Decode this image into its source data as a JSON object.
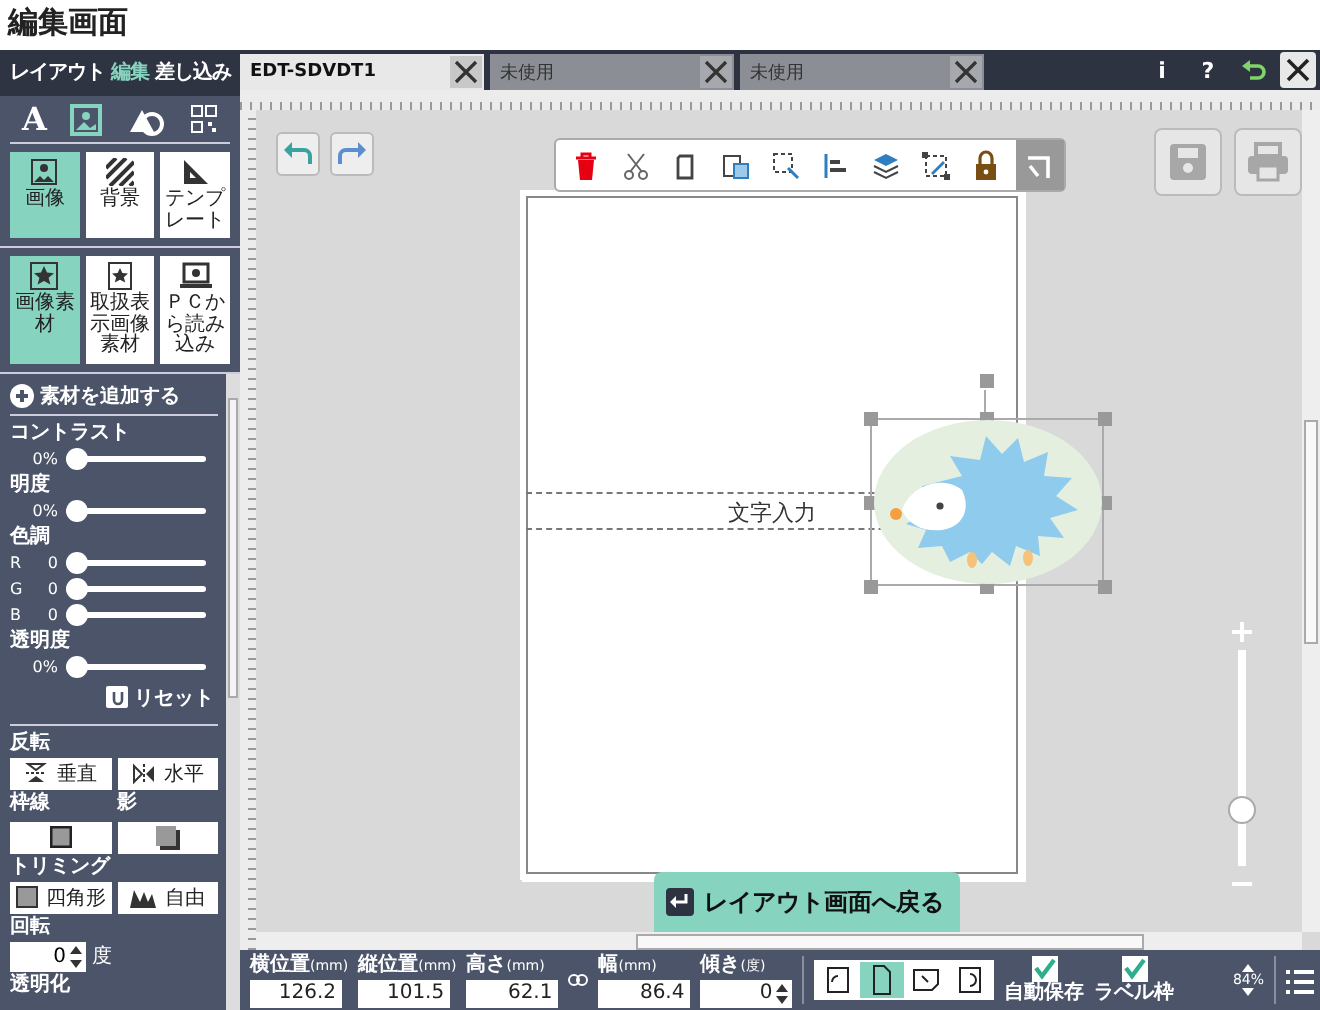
{
  "page_title": "編集画面",
  "sidebar": {
    "tabs": [
      {
        "label": "レイアウト",
        "selected": false
      },
      {
        "label": "編集",
        "selected": true
      },
      {
        "label": "差し込み",
        "selected": false
      }
    ],
    "tools": [
      {
        "kind": "text",
        "label": "A",
        "selected": false
      },
      {
        "kind": "image",
        "selected": true
      },
      {
        "kind": "shape",
        "selected": false
      },
      {
        "kind": "code",
        "selected": false
      }
    ],
    "categories": [
      {
        "kind": "image",
        "label": "画像",
        "selected": true
      },
      {
        "kind": "pattern",
        "label": "背景",
        "selected": false
      },
      {
        "kind": "template",
        "label": "テンプレート",
        "selected": false
      }
    ],
    "sources": [
      {
        "kind": "star",
        "label": "画像素材",
        "selected": true
      },
      {
        "kind": "star-card",
        "label": "取扱表示画像素材",
        "selected": false
      },
      {
        "kind": "pc",
        "label": "ＰＣから読み込み",
        "selected": false
      }
    ],
    "add_button": "素材を追加する",
    "adjustments": [
      {
        "label": "コントラスト",
        "sliders": [
          {
            "reading": "0%",
            "level": 0
          }
        ]
      },
      {
        "label": "明度",
        "sliders": [
          {
            "reading": "0%",
            "level": 0
          }
        ]
      },
      {
        "label": "色調",
        "sliders": [
          {
            "channel": "R",
            "reading": "0",
            "level": 0
          },
          {
            "channel": "G",
            "reading": "0",
            "level": 0
          },
          {
            "channel": "B",
            "reading": "0",
            "level": 0
          }
        ]
      },
      {
        "label": "透明度",
        "sliders": [
          {
            "reading": "0%",
            "level": 0
          }
        ]
      }
    ],
    "reset_button": "リセット",
    "flip": {
      "label": "反転",
      "buttons": [
        {
          "kind": "vertical",
          "label": "垂直"
        },
        {
          "kind": "horizontal",
          "label": "水平"
        }
      ]
    },
    "frame_label": "枠線",
    "shadow_label": "影",
    "trimming": {
      "label": "トリミング",
      "buttons": [
        {
          "kind": "rect",
          "label": "四角形"
        },
        {
          "kind": "free",
          "label": "自由"
        }
      ]
    },
    "rotation": {
      "label": "回転",
      "value": "0",
      "unit": "度"
    },
    "next_section": "透明化"
  },
  "tabs": [
    {
      "label": "EDT-SDVDT1",
      "selected": true
    },
    {
      "label": "未使用",
      "selected": false
    },
    {
      "label": "未使用",
      "selected": false
    }
  ],
  "header_buttons": [
    {
      "kind": "info",
      "label": "i"
    },
    {
      "kind": "help",
      "label": "?"
    },
    {
      "kind": "undo"
    },
    {
      "kind": "close"
    }
  ],
  "edit_toolbar": [
    {
      "kind": "delete"
    },
    {
      "kind": "cut"
    },
    {
      "kind": "copy"
    },
    {
      "kind": "paste"
    },
    {
      "kind": "select"
    },
    {
      "kind": "align"
    },
    {
      "kind": "layers"
    },
    {
      "kind": "transform"
    },
    {
      "kind": "lock"
    },
    {
      "kind": "collapse"
    }
  ],
  "canvas": {
    "text_object": "文字入力",
    "zoom": {
      "level": 0.22
    }
  },
  "back_button": "レイアウト画面へ戻る",
  "properties": [
    {
      "label": "横位置",
      "unit": "(mm)",
      "value": "126.2"
    },
    {
      "label": "縦位置",
      "unit": "(mm)",
      "value": "101.5"
    },
    {
      "label": "高さ",
      "unit": "(mm)",
      "value": "62.1"
    },
    {
      "label": "幅",
      "unit": "(mm)",
      "value": "86.4"
    },
    {
      "label": "傾き",
      "unit": "(度)",
      "value": "0"
    }
  ],
  "orientations": [
    {
      "kind": "rotate-left",
      "selected": false
    },
    {
      "kind": "portrait",
      "selected": true
    },
    {
      "kind": "rotate-right",
      "selected": false
    },
    {
      "kind": "flip",
      "selected": false
    }
  ],
  "toggles": [
    {
      "label": "自動保存",
      "checked": true
    },
    {
      "label": "ラベル枠",
      "checked": true
    }
  ],
  "zoom_reading": "84%"
}
